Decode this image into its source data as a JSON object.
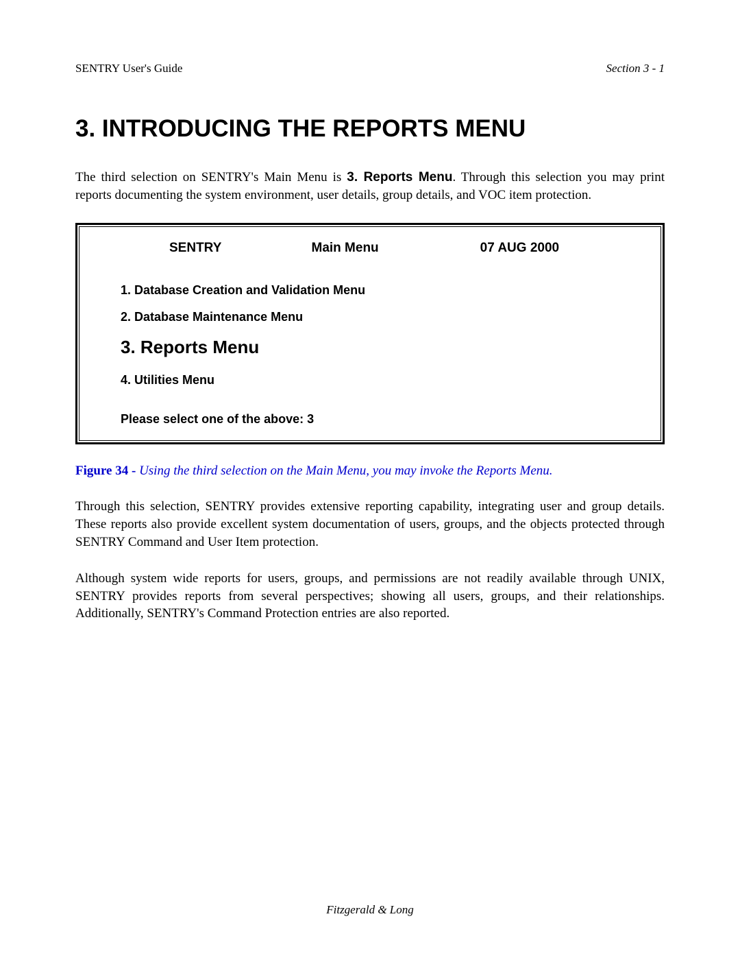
{
  "header": {
    "left": "SENTRY User's Guide",
    "right": "Section 3 - 1"
  },
  "heading": "3.  INTRODUCING THE REPORTS MENU",
  "intro": {
    "pre": "The third selection on SENTRY's Main Menu is ",
    "bold": "3. Reports Menu",
    "post": ".    Through this selection you may print reports documenting the system environment, user details, group details, and VOC item protection."
  },
  "menuBox": {
    "headerLeft": "SENTRY",
    "headerCenter": "Main Menu",
    "headerRight": "07 AUG 2000",
    "items": [
      {
        "text": "1. Database Creation and Validation Menu",
        "emphasis": false
      },
      {
        "text": "2. Database Maintenance Menu",
        "emphasis": false
      },
      {
        "text": "3. Reports Menu",
        "emphasis": true
      },
      {
        "text": "4. Utilities Menu",
        "emphasis": false
      }
    ],
    "prompt": "Please select one of the above:   3"
  },
  "figure": {
    "label": "Figure 34 - ",
    "desc": "Using the third selection on the Main Menu, you may invoke the Reports Menu."
  },
  "para2": "Through this selection, SENTRY provides extensive reporting capability, integrating user and group details.  These reports also provide excellent system documentation of users, groups, and the objects protected through SENTRY Command and User Item protection.",
  "para3": "Although system wide reports for users, groups, and permissions are not readily available through UNIX, SENTRY provides reports from several perspectives; showing all users, groups, and their relationships.  Additionally, SENTRY's Command Protection entries are also reported.",
  "footer": "Fitzgerald & Long"
}
